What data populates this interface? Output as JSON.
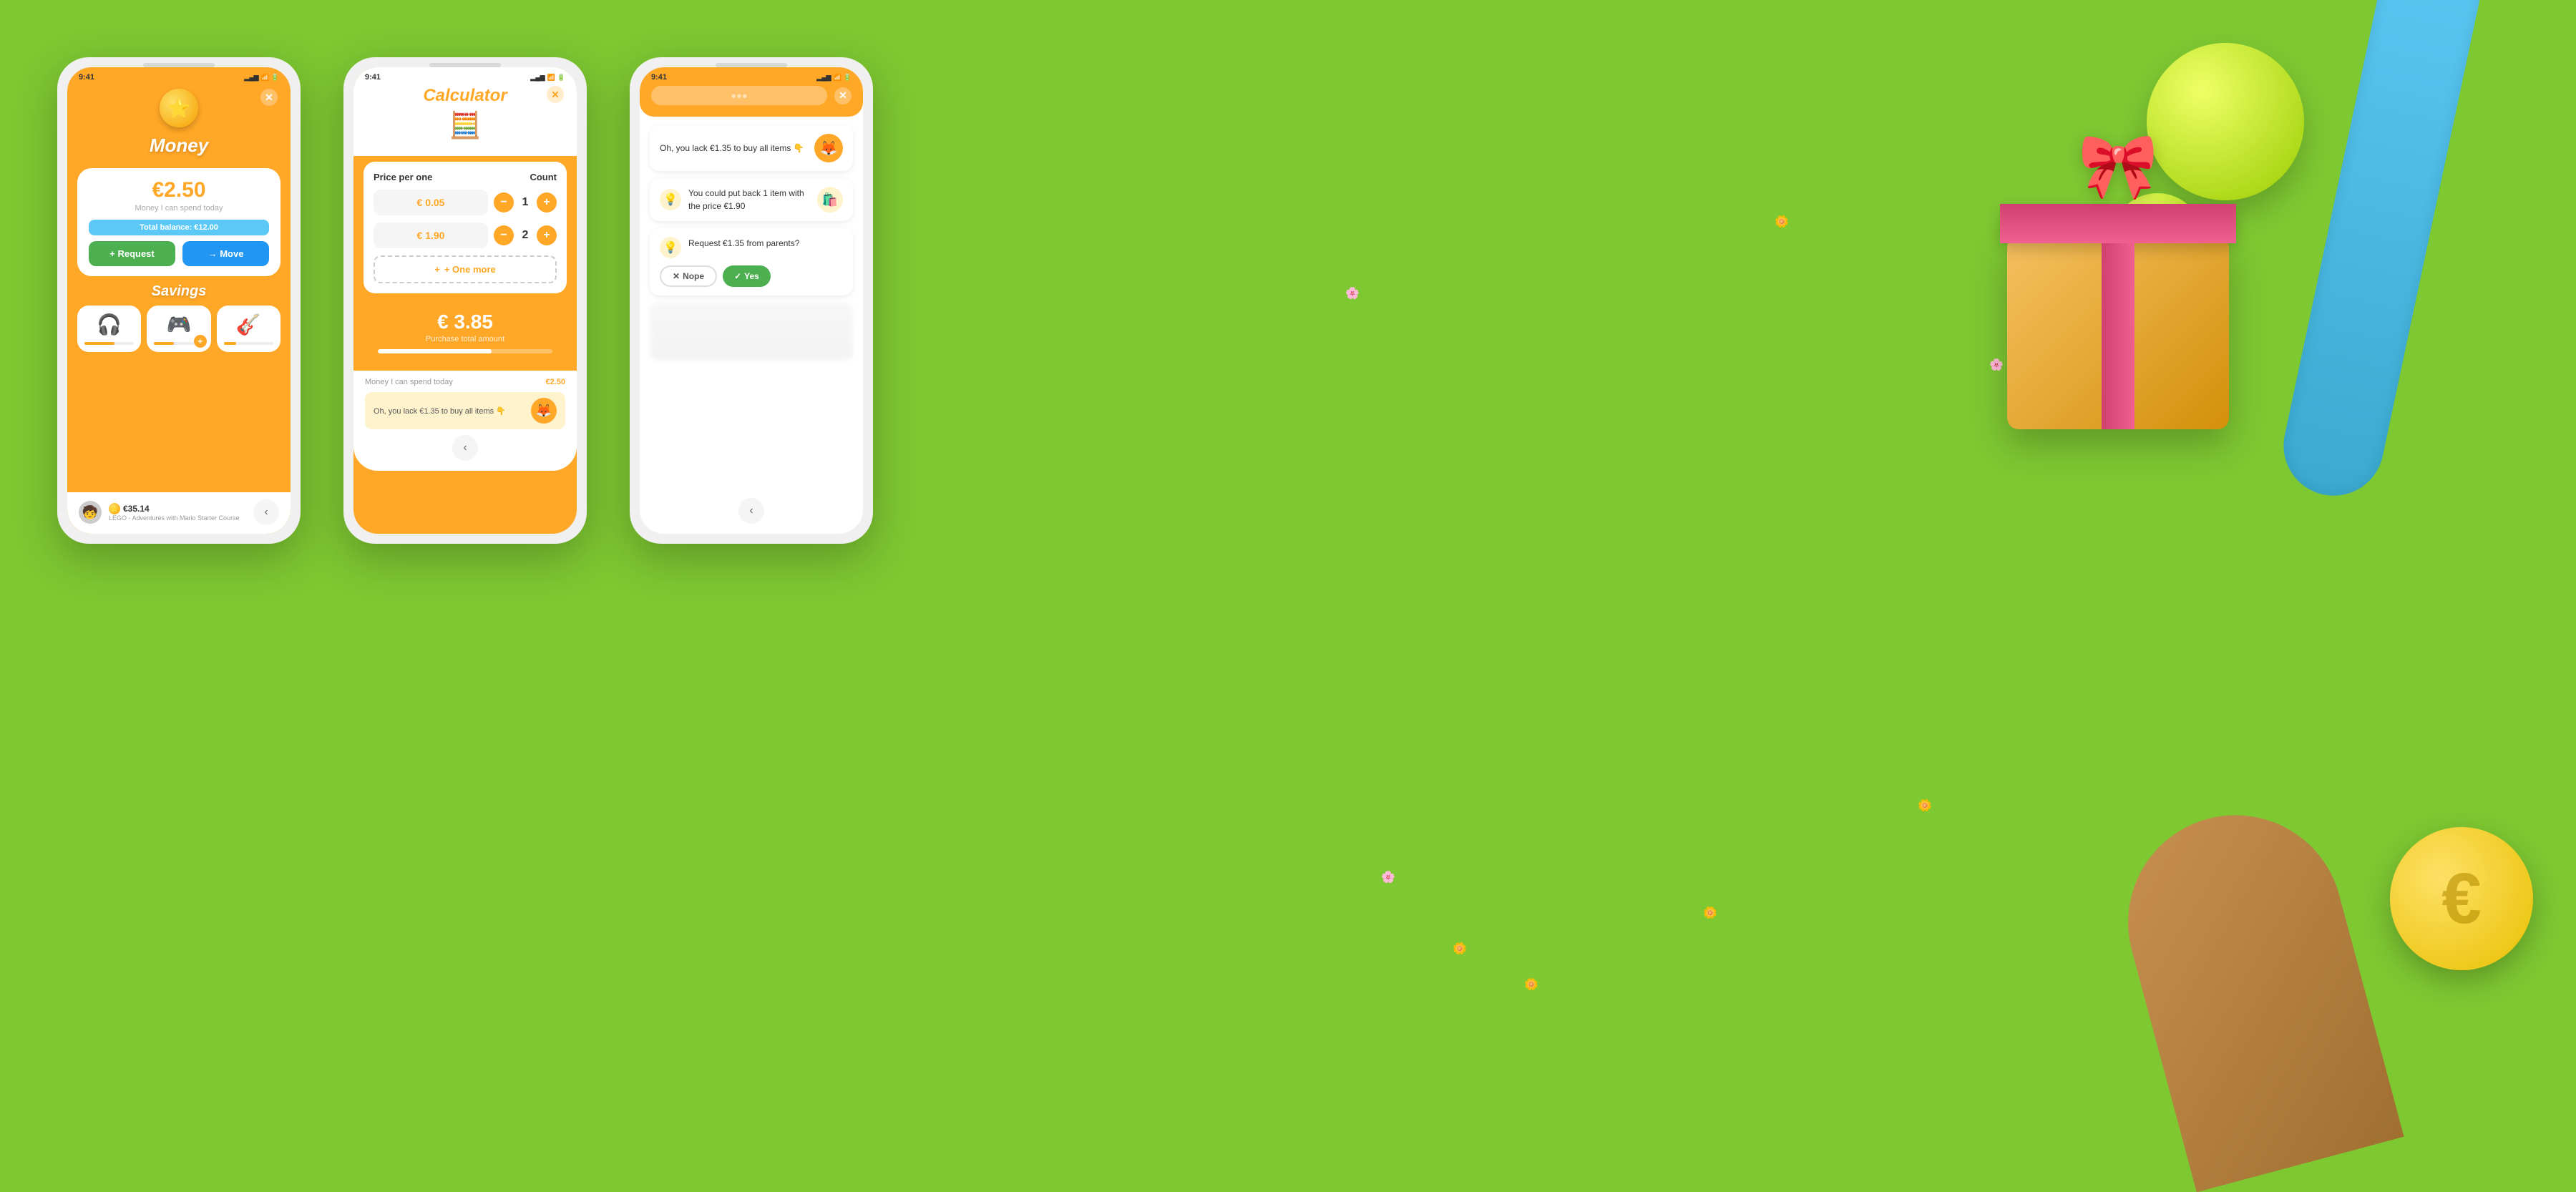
{
  "background": {
    "color": "#7ec832"
  },
  "phone1": {
    "status_time": "9:41",
    "title": "Money",
    "balance": "€2.50",
    "balance_label": "Money I can spend today",
    "total_balance": "Total balance: €12.00",
    "btn_request": "+ Request",
    "btn_move": "→ Move",
    "savings_title": "Savings",
    "savings_items": [
      {
        "icon": "🎧",
        "progress": 60
      },
      {
        "icon": "🎮",
        "progress": 40,
        "has_add": true
      },
      {
        "icon": "🎸",
        "progress": 25
      }
    ],
    "bottom_price": "€35.14",
    "bottom_title": "LEGO - Adventures with Mario Starter Course"
  },
  "phone2": {
    "status_time": "9:41",
    "title": "Calculator",
    "icon": "🧮",
    "col_price": "Price per one",
    "col_count": "Count",
    "items": [
      {
        "price": "€ 0.05",
        "count": 1
      },
      {
        "price": "€ 1.90",
        "count": 2
      }
    ],
    "btn_one_more": "+ One more",
    "total": "€ 3.85",
    "total_label": "Purchase total amount",
    "spend_label": "Money I can spend today",
    "spend_value": "€2.50",
    "warning": "Oh, you lack €1.35 to buy all items 👇"
  },
  "phone3": {
    "status_time": "9:41",
    "alert_text": "Oh, you lack €1.35 to buy all items 👇",
    "suggestion1": "You could put back 1 item with the price €1.90",
    "suggestion2": "Request €1.35 from parents?",
    "btn_nope": "Nope",
    "btn_yes": "Yes"
  }
}
